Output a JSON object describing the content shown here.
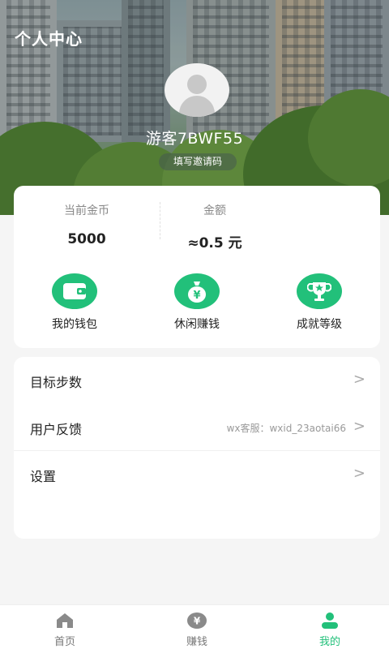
{
  "header": {
    "title": "个人中心",
    "user_name": "游客7BWF55",
    "invite_label": "填写邀请码"
  },
  "wallet": {
    "coins_label": "当前金币",
    "coins_value": "5000",
    "amount_label": "金额",
    "amount_value": "≈0.5 元"
  },
  "actions": [
    {
      "label": "我的钱包",
      "icon": "wallet-icon"
    },
    {
      "label": "休闲赚钱",
      "icon": "money-bag-icon",
      "glyph": "¥"
    },
    {
      "label": "成就等级",
      "icon": "trophy-icon"
    }
  ],
  "menu": [
    {
      "label": "目标步数",
      "extra": ""
    },
    {
      "label": "用户反馈",
      "extra": "wx客服：wxid_23aotai66"
    },
    {
      "label": "设置",
      "extra": ""
    }
  ],
  "nav": [
    {
      "label": "首页",
      "icon": "home-icon",
      "active": false
    },
    {
      "label": "赚钱",
      "icon": "yen-coin-icon",
      "glyph": "¥",
      "active": false
    },
    {
      "label": "我的",
      "icon": "profile-icon",
      "active": true
    }
  ],
  "colors": {
    "accent": "#22c07a",
    "background": "#f5f5f5"
  }
}
